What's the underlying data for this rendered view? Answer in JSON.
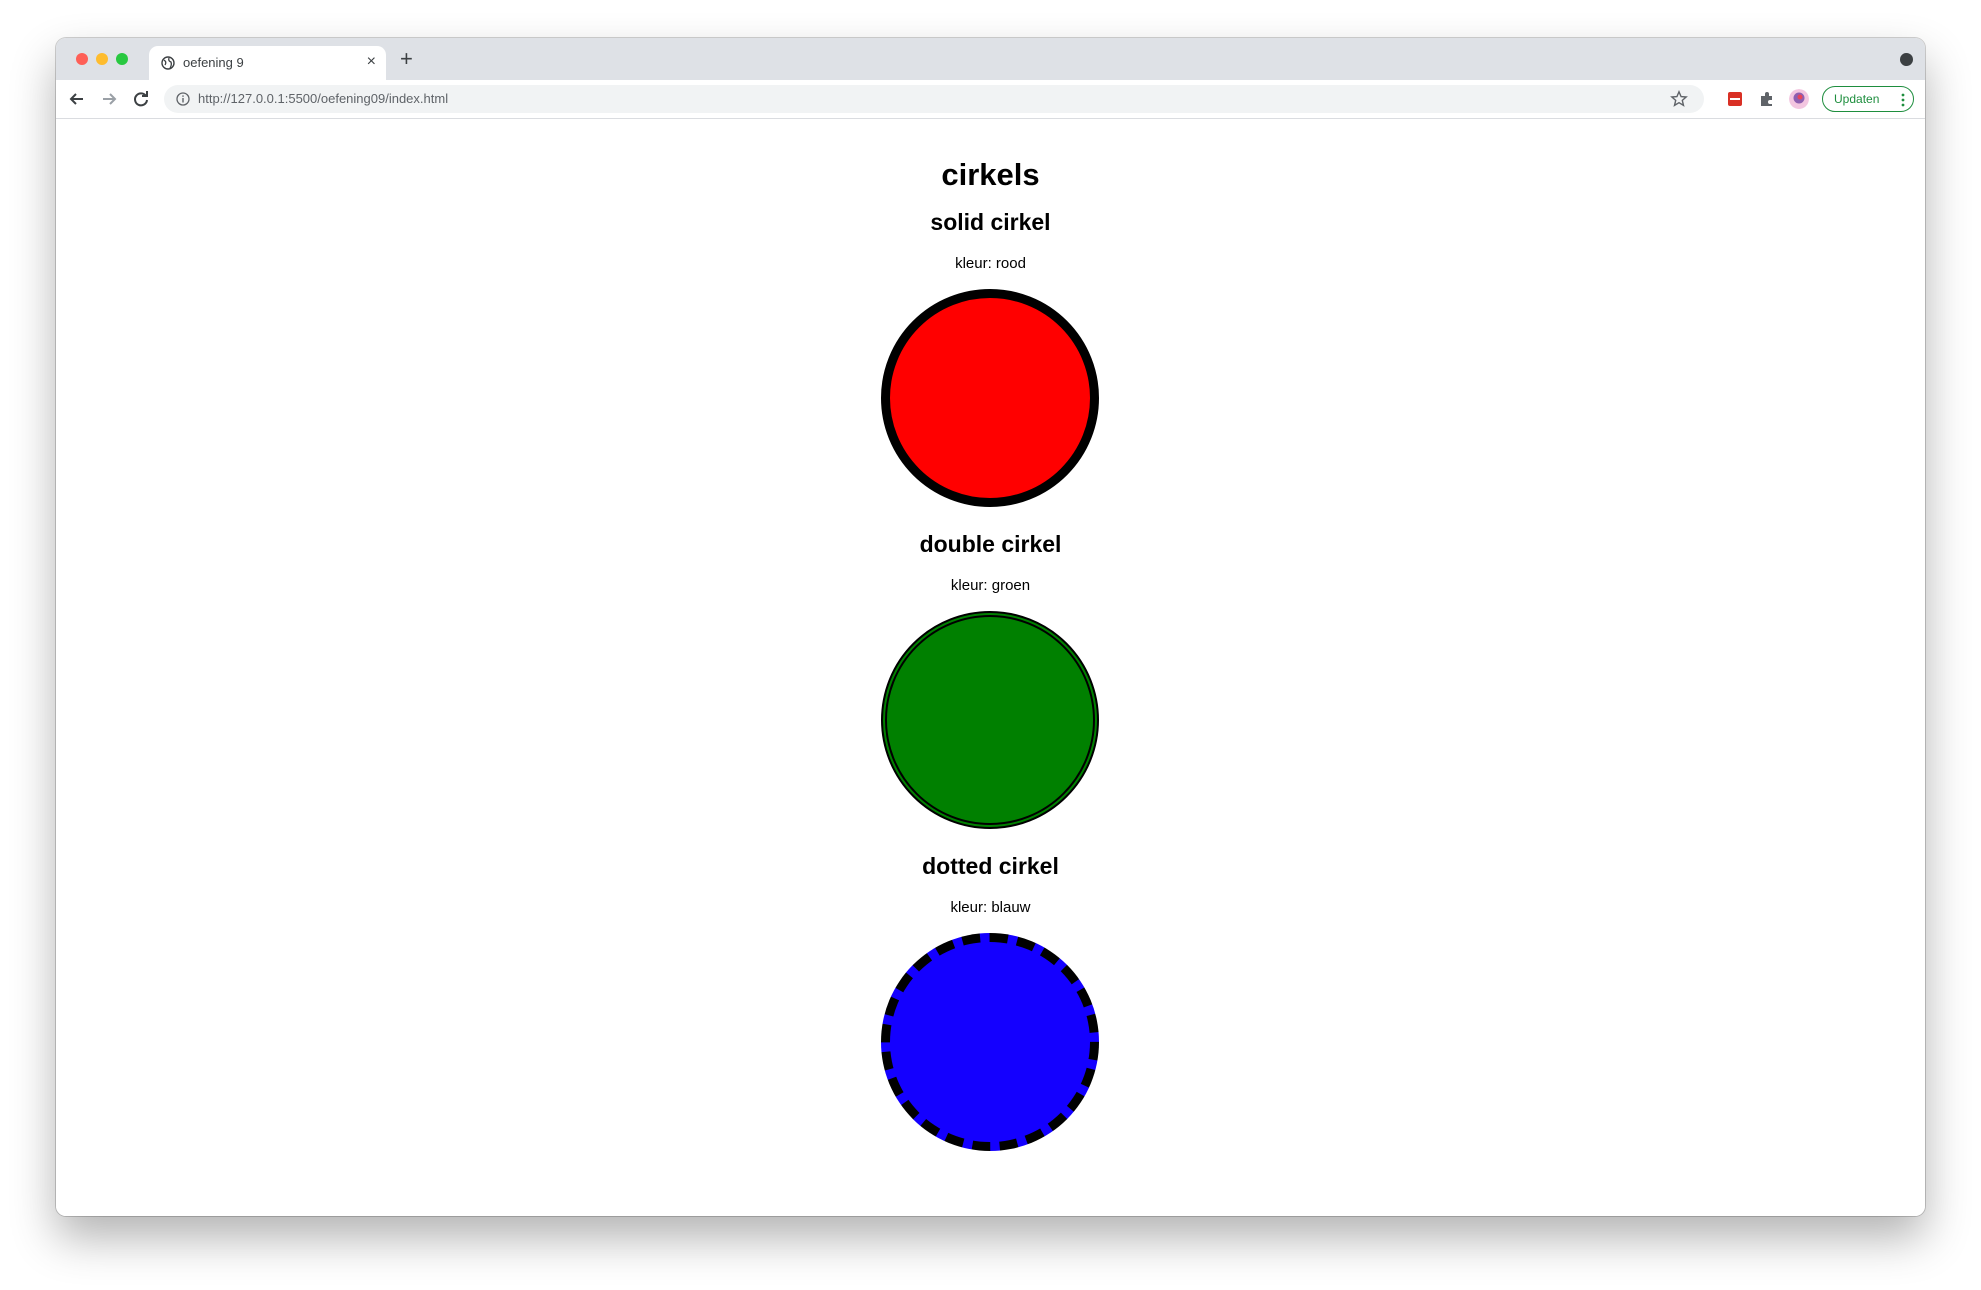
{
  "browser": {
    "tab_title": "oefening 9",
    "tab_close": "×",
    "new_tab": "+",
    "url": "http://127.0.0.1:5500/oefening09/index.html",
    "update_label": "Updaten"
  },
  "page": {
    "title": "cirkels",
    "sections": [
      {
        "heading": "solid cirkel",
        "color_label": "kleur: rood",
        "fill": "#ff0000",
        "border_style": "solid"
      },
      {
        "heading": "double cirkel",
        "color_label": "kleur: groen",
        "fill": "#008000",
        "border_style": "double"
      },
      {
        "heading": "dotted cirkel",
        "color_label": "kleur: blauw",
        "fill": "#1400ff",
        "border_style": "dashed"
      }
    ]
  },
  "colors": {
    "tabstrip": "#dee1e6",
    "update_green": "#1e8e3e",
    "ext_red": "#d93025"
  }
}
